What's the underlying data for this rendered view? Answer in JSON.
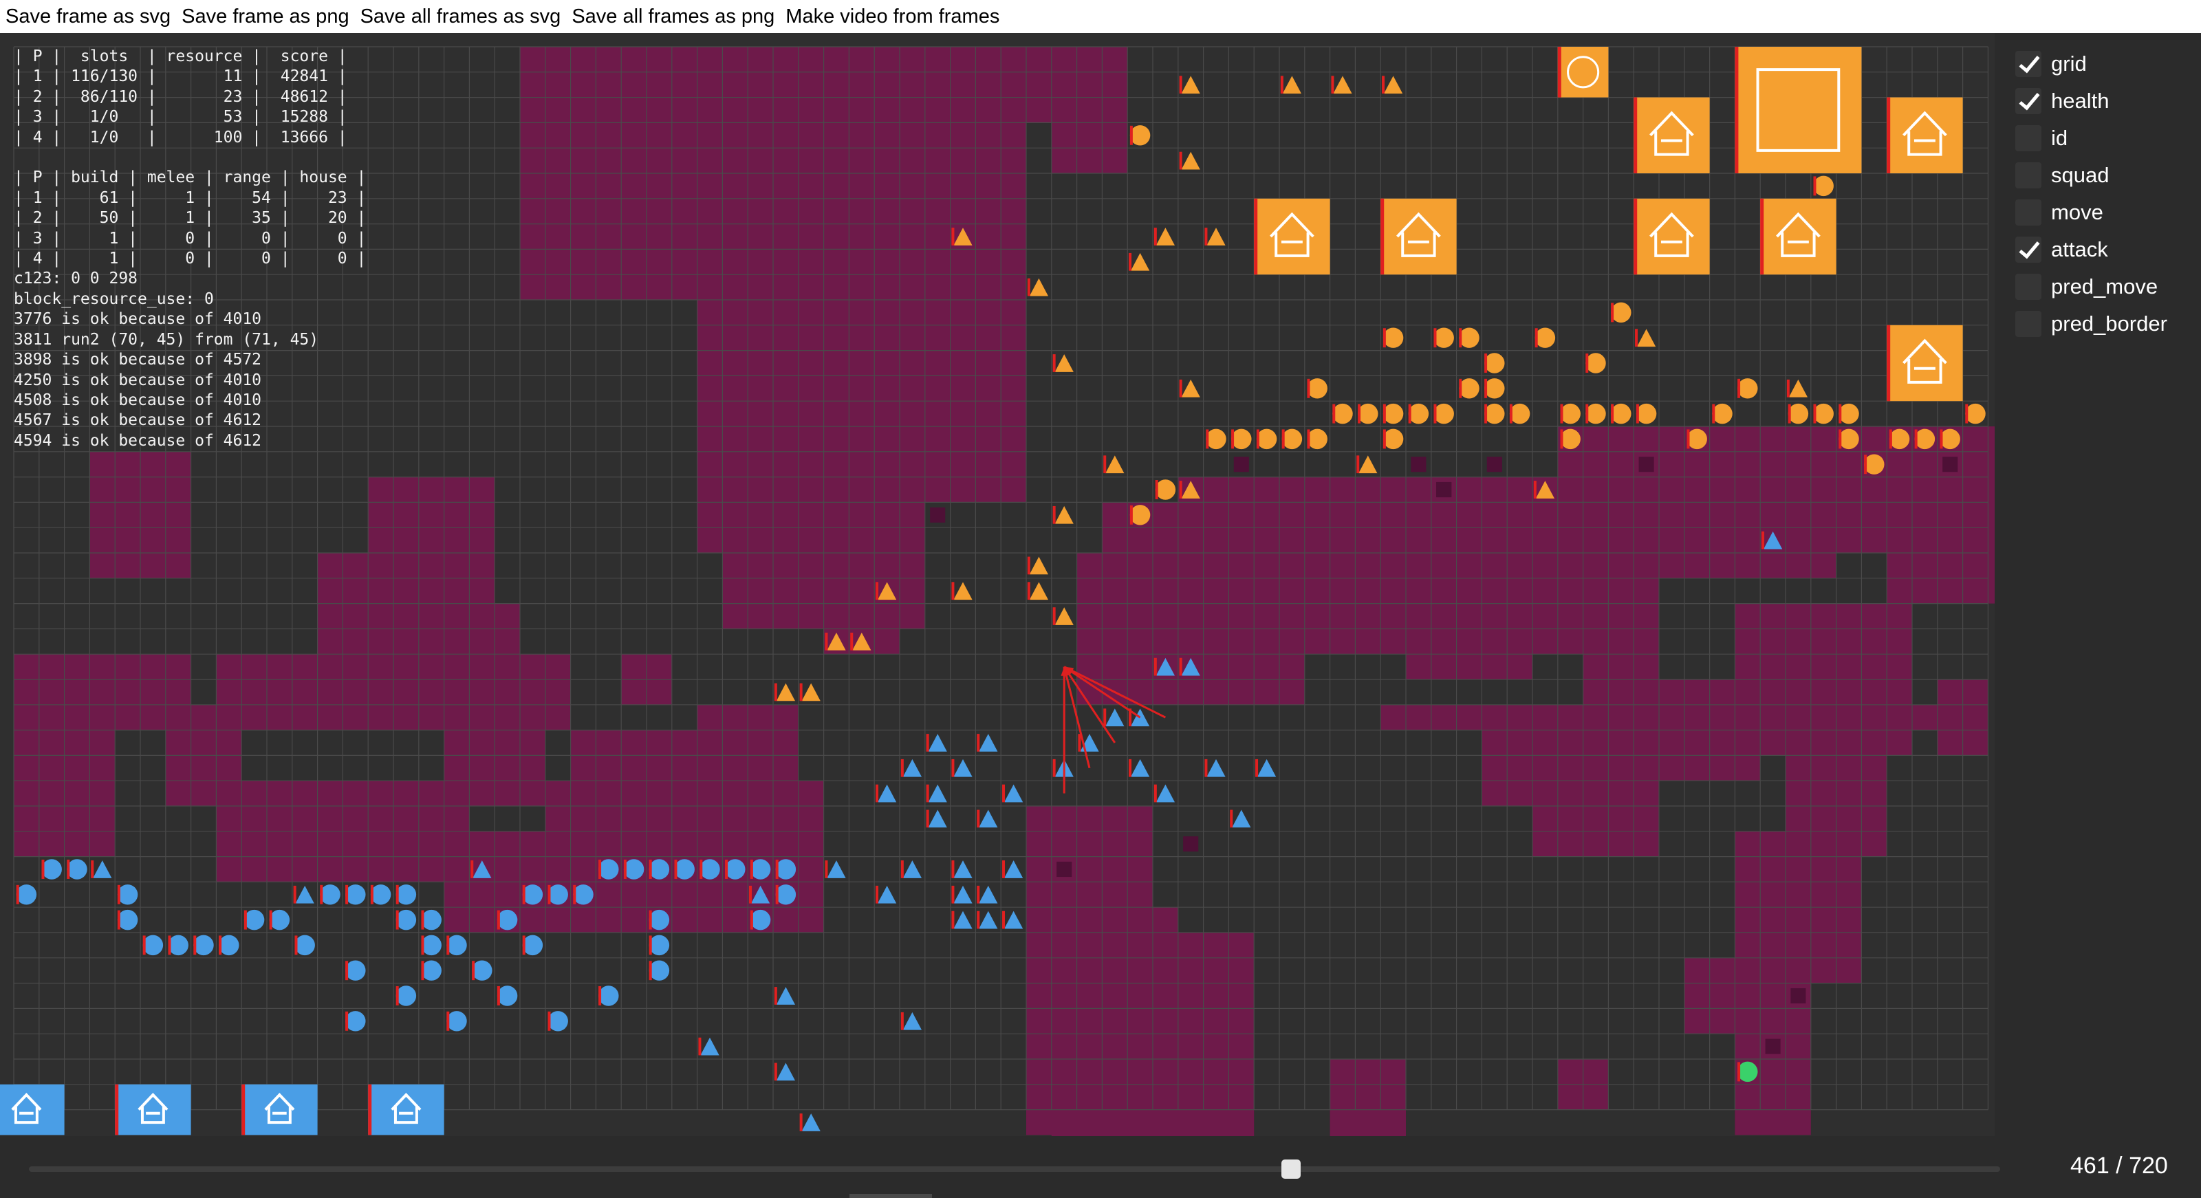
{
  "menu": [
    "Save frame as svg",
    "Save frame as png",
    "Save all frames as svg",
    "Save all frames as png",
    "Make video from frames"
  ],
  "overlay_lines": [
    "| P |  slots  | resource |  score |",
    "| 1 | 116/130 |       11 |  42841 |",
    "| 2 |  86/110 |       23 |  48612 |",
    "| 3 |   1/0   |       53 |  15288 |",
    "| 4 |   1/0   |      100 |  13666 |",
    "",
    "| P | build | melee | range | house |",
    "| 1 |    61 |     1 |    54 |    23 |",
    "| 2 |    50 |     1 |    35 |    20 |",
    "| 3 |     1 |     0 |     0 |     0 |",
    "| 4 |     1 |     0 |     0 |     0 |",
    "c123: 0 0 298",
    "block_resource_use: 0",
    "3776 is ok because of 4010",
    "3811 run2 (70, 45) from (71, 45)",
    "3898 is ok because of 4572",
    "4250 is ok because of 4010",
    "4508 is ok because of 4010",
    "4567 is ok because of 4612",
    "4594 is ok because of 4612"
  ],
  "checkboxes": [
    {
      "label": "grid",
      "checked": true
    },
    {
      "label": "health",
      "checked": true
    },
    {
      "label": "id",
      "checked": false
    },
    {
      "label": "squad",
      "checked": false
    },
    {
      "label": "move",
      "checked": false
    },
    {
      "label": "attack",
      "checked": true
    },
    {
      "label": "pred_move",
      "checked": false
    },
    {
      "label": "pred_border",
      "checked": false
    }
  ],
  "frame": {
    "current": 461,
    "total": 720,
    "label": "461 / 720"
  },
  "colors": {
    "player1": "#f5a030",
    "player2": "#4a9ee6",
    "player3": "#3ad16a",
    "resource": "#6e1a4a",
    "board": "#2f2f2f",
    "health": "#e02020"
  },
  "map": {
    "resource_rects": [
      [
        20,
        0,
        14,
        10
      ],
      [
        34,
        0,
        6,
        18
      ],
      [
        33,
        3,
        3,
        6
      ],
      [
        36,
        3,
        2,
        8
      ],
      [
        40,
        0,
        2,
        3
      ],
      [
        41,
        0,
        3,
        5
      ],
      [
        27,
        10,
        9,
        10
      ],
      [
        28,
        15,
        8,
        8
      ],
      [
        32,
        20,
        3,
        4
      ],
      [
        3,
        16,
        4,
        5
      ],
      [
        14,
        17,
        5,
        5
      ],
      [
        12,
        20,
        7,
        5
      ],
      [
        17,
        22,
        3,
        5
      ],
      [
        0,
        24,
        7,
        3
      ],
      [
        8,
        24,
        14,
        3
      ],
      [
        20,
        24,
        2,
        1
      ],
      [
        24,
        24,
        2,
        2
      ],
      [
        6,
        26,
        3,
        4
      ],
      [
        17,
        26,
        4,
        4
      ],
      [
        27,
        26,
        4,
        5
      ],
      [
        22,
        27,
        7,
        3
      ],
      [
        0,
        27,
        4,
        5
      ],
      [
        8,
        29,
        10,
        4
      ],
      [
        21,
        29,
        11,
        5
      ],
      [
        17,
        31,
        15,
        4
      ],
      [
        40,
        30,
        5,
        13
      ],
      [
        43,
        34,
        3,
        10
      ],
      [
        46,
        35,
        3,
        9
      ],
      [
        41,
        40,
        7,
        4
      ],
      [
        52,
        40,
        3,
        4
      ],
      [
        61,
        40,
        2,
        2
      ],
      [
        43,
        18,
        22,
        6
      ],
      [
        46,
        17,
        26,
        4
      ],
      [
        42,
        20,
        9,
        6
      ],
      [
        55,
        21,
        5,
        4
      ],
      [
        68,
        22,
        7,
        6
      ],
      [
        62,
        24,
        3,
        2
      ],
      [
        63,
        25,
        6,
        4
      ],
      [
        61,
        15,
        20,
        3
      ],
      [
        74,
        18,
        5,
        4
      ],
      [
        72,
        16,
        7,
        4
      ],
      [
        60,
        27,
        5,
        5
      ],
      [
        70,
        28,
        4,
        4
      ],
      [
        58,
        27,
        3,
        3
      ],
      [
        54,
        26,
        10,
        1
      ],
      [
        64,
        26,
        12,
        1
      ],
      [
        76,
        25,
        2,
        3
      ],
      [
        68,
        31,
        3,
        12
      ],
      [
        71,
        32,
        2,
        5
      ],
      [
        66,
        36,
        4,
        3
      ]
    ],
    "resource_nodes": [
      [
        36,
        18
      ],
      [
        56,
        17
      ],
      [
        55,
        16
      ],
      [
        48,
        16
      ],
      [
        70,
        37
      ],
      [
        69,
        39
      ],
      [
        58,
        16
      ],
      [
        61,
        15
      ],
      [
        64,
        16
      ],
      [
        41,
        32
      ],
      [
        46,
        31
      ],
      [
        56,
        17
      ],
      [
        76,
        16
      ]
    ],
    "p1_houses": [
      [
        49,
        6,
        3,
        3
      ],
      [
        54,
        6,
        3,
        3
      ],
      [
        64,
        2,
        3,
        3
      ],
      [
        69,
        6,
        3,
        3
      ],
      [
        64,
        6,
        3,
        3
      ],
      [
        74,
        2,
        3,
        3
      ],
      [
        74,
        11,
        3,
        3
      ]
    ],
    "p1_big_house": [
      68,
      0,
      5,
      5
    ],
    "p1_hub": [
      61,
      0,
      2,
      2
    ],
    "p2_houses": [
      [
        -1,
        41,
        3,
        2
      ],
      [
        4,
        41,
        3,
        2
      ],
      [
        9,
        41,
        3,
        2
      ],
      [
        14,
        41,
        3,
        2
      ]
    ],
    "p1_circles": [
      [
        44,
        3
      ],
      [
        71,
        5
      ],
      [
        44,
        18
      ],
      [
        45,
        17
      ],
      [
        63,
        10
      ],
      [
        54,
        11
      ],
      [
        56,
        11
      ],
      [
        57,
        11
      ],
      [
        60,
        11
      ],
      [
        62,
        12
      ],
      [
        58,
        12
      ],
      [
        51,
        13
      ],
      [
        57,
        13
      ],
      [
        58,
        13
      ],
      [
        68,
        13
      ],
      [
        52,
        14
      ],
      [
        53,
        14
      ],
      [
        54,
        14
      ],
      [
        55,
        14
      ],
      [
        56,
        14
      ],
      [
        58,
        14
      ],
      [
        59,
        14
      ],
      [
        61,
        14
      ],
      [
        62,
        14
      ],
      [
        63,
        14
      ],
      [
        64,
        14
      ],
      [
        67,
        14
      ],
      [
        70,
        14
      ],
      [
        71,
        14
      ],
      [
        72,
        14
      ],
      [
        77,
        14
      ],
      [
        47,
        15
      ],
      [
        48,
        15
      ],
      [
        49,
        15
      ],
      [
        50,
        15
      ],
      [
        51,
        15
      ],
      [
        54,
        15
      ],
      [
        61,
        15
      ],
      [
        66,
        15
      ],
      [
        72,
        15
      ],
      [
        74,
        15
      ],
      [
        75,
        15
      ],
      [
        76,
        15
      ],
      [
        73,
        16
      ]
    ],
    "p1_triangles": [
      [
        46,
        1
      ],
      [
        50,
        1
      ],
      [
        52,
        1
      ],
      [
        54,
        1
      ],
      [
        46,
        4
      ],
      [
        37,
        7
      ],
      [
        45,
        7
      ],
      [
        47,
        7
      ],
      [
        44,
        8
      ],
      [
        40,
        9
      ],
      [
        41,
        12
      ],
      [
        64,
        11
      ],
      [
        70,
        13
      ],
      [
        46,
        13
      ],
      [
        43,
        16
      ],
      [
        46,
        17
      ],
      [
        53,
        16
      ],
      [
        60,
        17
      ],
      [
        41,
        18
      ],
      [
        40,
        20
      ],
      [
        34,
        21
      ],
      [
        37,
        21
      ],
      [
        40,
        21
      ],
      [
        41,
        22
      ],
      [
        32,
        23
      ],
      [
        33,
        23
      ],
      [
        30,
        25
      ],
      [
        31,
        25
      ]
    ],
    "p2_circles": [
      [
        1,
        32
      ],
      [
        2,
        32
      ],
      [
        23,
        32
      ],
      [
        24,
        32
      ],
      [
        25,
        32
      ],
      [
        26,
        32
      ],
      [
        27,
        32
      ],
      [
        28,
        32
      ],
      [
        29,
        32
      ],
      [
        30,
        32
      ],
      [
        0,
        33
      ],
      [
        4,
        33
      ],
      [
        12,
        33
      ],
      [
        13,
        33
      ],
      [
        14,
        33
      ],
      [
        15,
        33
      ],
      [
        20,
        33
      ],
      [
        21,
        33
      ],
      [
        22,
        33
      ],
      [
        30,
        33
      ],
      [
        4,
        34
      ],
      [
        9,
        34
      ],
      [
        10,
        34
      ],
      [
        15,
        34
      ],
      [
        16,
        34
      ],
      [
        19,
        34
      ],
      [
        25,
        34
      ],
      [
        29,
        34
      ],
      [
        5,
        35
      ],
      [
        6,
        35
      ],
      [
        7,
        35
      ],
      [
        8,
        35
      ],
      [
        11,
        35
      ],
      [
        16,
        35
      ],
      [
        17,
        35
      ],
      [
        20,
        35
      ],
      [
        25,
        35
      ],
      [
        13,
        36
      ],
      [
        16,
        36
      ],
      [
        18,
        36
      ],
      [
        25,
        36
      ],
      [
        15,
        37
      ],
      [
        19,
        37
      ],
      [
        23,
        37
      ],
      [
        13,
        38
      ],
      [
        17,
        38
      ],
      [
        21,
        38
      ]
    ],
    "p2_triangles": [
      [
        69,
        19
      ],
      [
        45,
        24
      ],
      [
        46,
        24
      ],
      [
        43,
        26
      ],
      [
        44,
        26
      ],
      [
        42,
        27
      ],
      [
        36,
        27
      ],
      [
        38,
        27
      ],
      [
        35,
        28
      ],
      [
        37,
        28
      ],
      [
        41,
        28
      ],
      [
        44,
        28
      ],
      [
        47,
        28
      ],
      [
        49,
        28
      ],
      [
        34,
        29
      ],
      [
        36,
        29
      ],
      [
        39,
        29
      ],
      [
        45,
        29
      ],
      [
        36,
        30
      ],
      [
        38,
        30
      ],
      [
        48,
        30
      ],
      [
        35,
        32
      ],
      [
        37,
        32
      ],
      [
        39,
        32
      ],
      [
        32,
        32
      ],
      [
        37,
        33
      ],
      [
        38,
        33
      ],
      [
        29,
        33
      ],
      [
        34,
        33
      ],
      [
        37,
        34
      ],
      [
        38,
        34
      ],
      [
        39,
        34
      ],
      [
        30,
        37
      ],
      [
        35,
        38
      ],
      [
        27,
        39
      ],
      [
        30,
        40
      ],
      [
        31,
        42
      ],
      [
        3,
        32
      ],
      [
        11,
        33
      ],
      [
        18,
        32
      ]
    ],
    "p3_circles": [
      [
        68,
        40
      ]
    ],
    "attack_lines": [
      [
        [
          41,
          24
        ],
        [
          45,
          26
        ]
      ],
      [
        [
          41,
          24
        ],
        [
          43,
          27
        ]
      ],
      [
        [
          41,
          24
        ],
        [
          42,
          28
        ]
      ],
      [
        [
          41,
          24
        ],
        [
          41,
          29
        ]
      ],
      [
        [
          41,
          24
        ],
        [
          44,
          26
        ]
      ]
    ]
  }
}
